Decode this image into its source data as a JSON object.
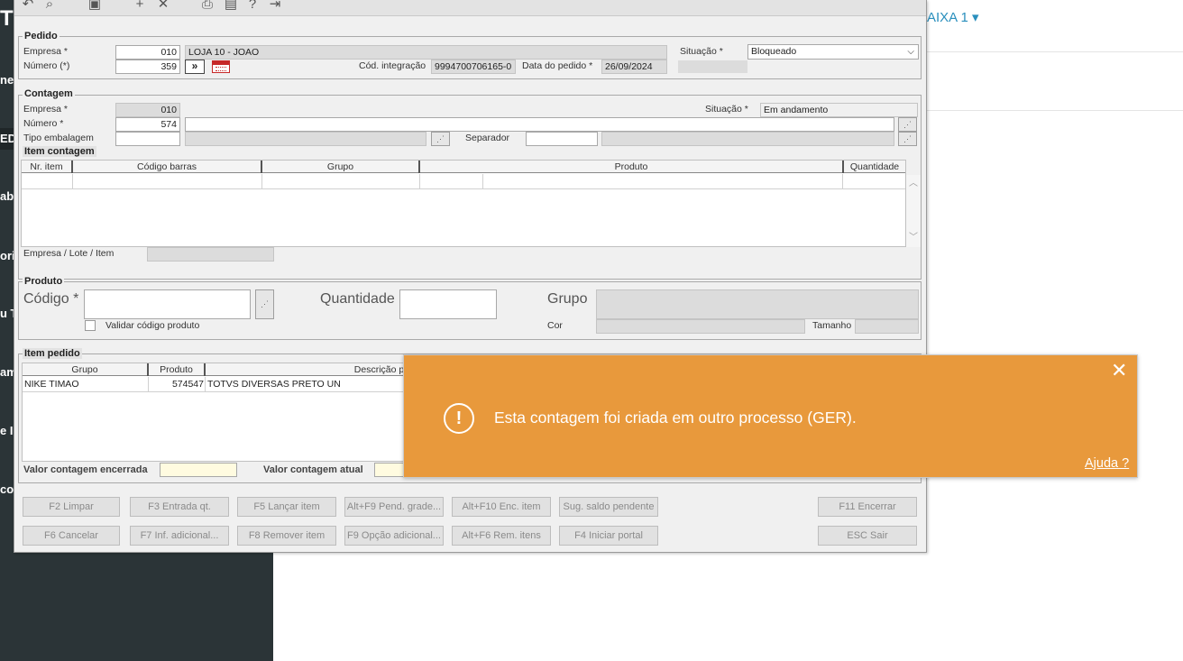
{
  "background_app": {
    "logo_fragment": "T",
    "sidebar_fragments": [
      "ne",
      "ED",
      "ab",
      "ori",
      "u T",
      "am",
      "e I",
      "co"
    ],
    "top_link": "AIXA 1 ▾"
  },
  "toolbar": {
    "icons": [
      "undo-icon",
      "search-icon",
      "save-icon",
      "add-icon",
      "close-icon",
      "print-icon",
      "archive-icon",
      "help-icon",
      "exit-icon"
    ]
  },
  "pedido": {
    "legend": "Pedido",
    "empresa_label": "Empresa *",
    "empresa_value": "010",
    "empresa_name": "LOJA 10 - JOAO",
    "numero_label": "Número (*)",
    "numero_value": "359",
    "next_button": "»",
    "situacao_label": "Situação *",
    "situacao_value": "Bloqueado",
    "cod_integracao_label": "Cód. integração",
    "cod_integracao_value": "9994700706165-0",
    "data_label": "Data do pedido *",
    "data_value": "26/09/2024"
  },
  "contagem": {
    "legend": "Contagem",
    "empresa_label": "Empresa *",
    "empresa_value": "010",
    "numero_label": "Número *",
    "numero_value": "574",
    "tipo_label": "Tipo embalagem",
    "situacao_label": "Situação *",
    "situacao_value": "Em andamento",
    "separador_label": "Separador"
  },
  "item_contagem": {
    "legend": "Item contagem",
    "columns": [
      "Nr. item",
      "Código barras",
      "Grupo",
      "Produto",
      "Quantidade"
    ],
    "empresa_lote_label": "Empresa / Lote / Item"
  },
  "produto": {
    "legend": "Produto",
    "codigo_label": "Código *",
    "quantidade_label": "Quantidade",
    "grupo_label": "Grupo",
    "validar_label": "Validar código produto",
    "cor_label": "Cor",
    "tamanho_label": "Tamanho"
  },
  "item_pedido": {
    "legend": "Item pedido",
    "columns": [
      "Grupo",
      "Produto",
      "Descrição produto"
    ],
    "rows": [
      {
        "grupo": "NIKE TIMAO",
        "produto": "574547",
        "descricao": "TOTVS DIVERSAS PRETO UN"
      }
    ],
    "valor_encerrada_label": "Valor contagem encerrada",
    "valor_atual_label": "Valor contagem atual"
  },
  "buttons": {
    "row1": [
      "F2 Limpar",
      "F3 Entrada qt.",
      "F5 Lançar item",
      "Alt+F9 Pend. grade...",
      "Alt+F10 Enc. item",
      "Sug. saldo pendente"
    ],
    "row2": [
      "F6 Cancelar",
      "F7 Inf. adicional...",
      "F8 Remover item",
      "F9 Opção adicional...",
      "Alt+F6 Rem. itens",
      "F4 Iniciar portal"
    ],
    "encerrar": "F11 Encerrar",
    "sair": "ESC Sair"
  },
  "toast": {
    "message": "Esta contagem foi criada em outro processo (GER).",
    "close": "✕",
    "help": "Ajuda ?",
    "color": "#e8993c"
  }
}
